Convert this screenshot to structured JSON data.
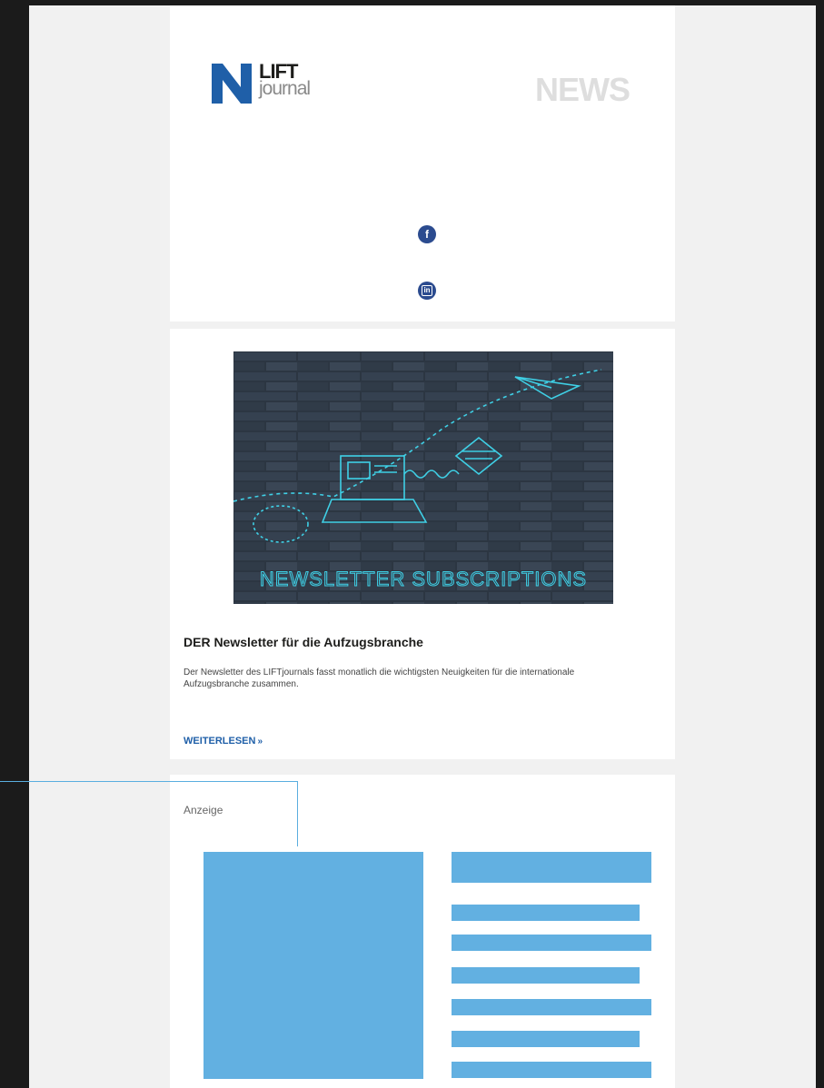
{
  "header": {
    "logo_top": "LIFT",
    "logo_bottom": "journal",
    "news_label": "NEWS",
    "social": [
      {
        "icon": "facebook-icon",
        "glyph": "f"
      },
      {
        "icon": "linkedin-icon",
        "glyph": "in"
      }
    ]
  },
  "article": {
    "image_caption": "NEWSLETTER SUBSCRIPTIONS",
    "title": "DER Newsletter für die Aufzugsbranche",
    "body": "Der Newsletter des LIFTjournals fasst monatlich die wichtigsten Neuigkeiten für die internationale Aufzugsbranche zusammen.",
    "read_more": "WEITERLESEN",
    "read_more_arrows": "»"
  },
  "ad": {
    "label": "Anzeige"
  },
  "colors": {
    "brand_blue": "#1f5fa8",
    "placeholder_blue": "#62b0e1",
    "social_blue": "#2b4b8f"
  }
}
